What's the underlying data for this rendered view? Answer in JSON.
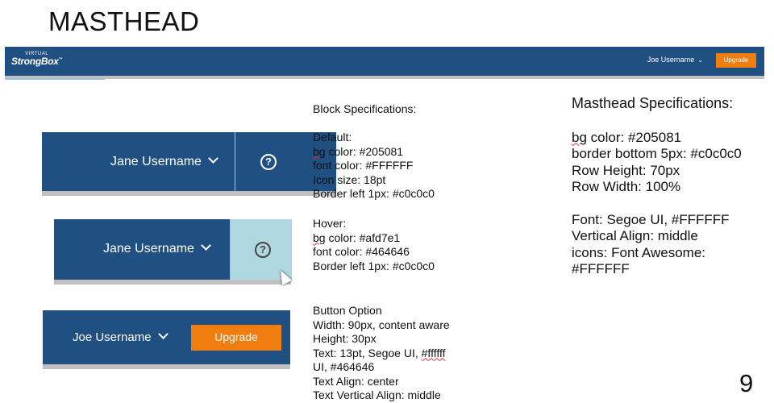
{
  "slide": {
    "title": "MASTHEAD",
    "page_number": "9"
  },
  "masthead_bar": {
    "logo_small": "VIRTUAL",
    "logo_big": "StrongBox",
    "logo_tm": "™",
    "username": "Joe Username",
    "chevron": "⌄",
    "upgrade_label": "Upgrade"
  },
  "examples": {
    "default_block": {
      "username": "Jane Username",
      "help_glyph": "?"
    },
    "hover_block": {
      "username": "Jane Username",
      "help_glyph": "?"
    },
    "button_block": {
      "username": "Joe Username",
      "upgrade_label": "Upgrade"
    }
  },
  "block_specs": {
    "heading": "Block Specifications:",
    "default_heading": "Default:",
    "default_lines": [
      "bg color: #205081",
      "font color: #FFFFFF",
      "Icon size: 18pt",
      "Border left 1px: #c0c0c0"
    ],
    "hover_heading": "Hover:",
    "hover_lines": [
      "bg color: #afd7e1",
      "font color: #464646",
      "Border left 1px: #c0c0c0"
    ],
    "button_heading": "Button Option",
    "button_lines": [
      "Width: 90px, content aware",
      "Height: 30px",
      "Text: 13pt, Segoe UI, #ffffff",
      "UI, #464646",
      "Text Align: center",
      "Text Vertical Align: middle"
    ]
  },
  "masthead_specs": {
    "heading": "Masthead Specifications:",
    "lines": [
      "bg color: #205081",
      "border bottom 5px: #c0c0c0",
      "Row Height: 70px",
      "Row Width: 100%"
    ],
    "lines2": [
      "Font: Segoe UI, #FFFFFF",
      "Vertical Align: middle",
      "icons: Font Awesome:",
      "#FFFFFF"
    ]
  },
  "colors": {
    "masthead_bg": "#205081",
    "border": "#c0c0c0",
    "hover_bg": "#afd7e1",
    "hover_font": "#464646",
    "upgrade": "#ef7d0f"
  }
}
